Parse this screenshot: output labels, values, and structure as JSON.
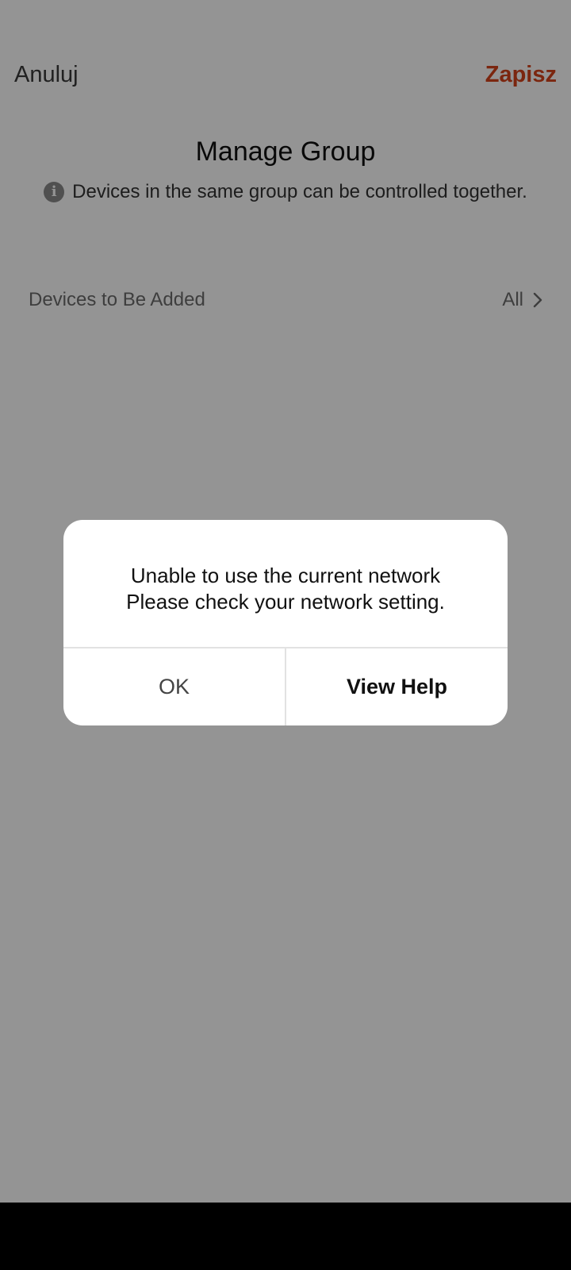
{
  "header": {
    "cancel_label": "Anuluj",
    "save_label": "Zapisz"
  },
  "page": {
    "title": "Manage Group",
    "info_text": "Devices in the same group can be controlled together."
  },
  "section": {
    "label": "Devices to Be Added",
    "all_label": "All"
  },
  "dialog": {
    "line1": "Unable to use the current network",
    "line2": "Please check your network setting.",
    "ok_label": "OK",
    "help_label": "View Help"
  },
  "colors": {
    "accent": "#d4431a",
    "overlay": "rgba(0,0,0,0.42)"
  },
  "icons": {
    "info": "info-icon",
    "chevron": "chevron-right-icon"
  }
}
